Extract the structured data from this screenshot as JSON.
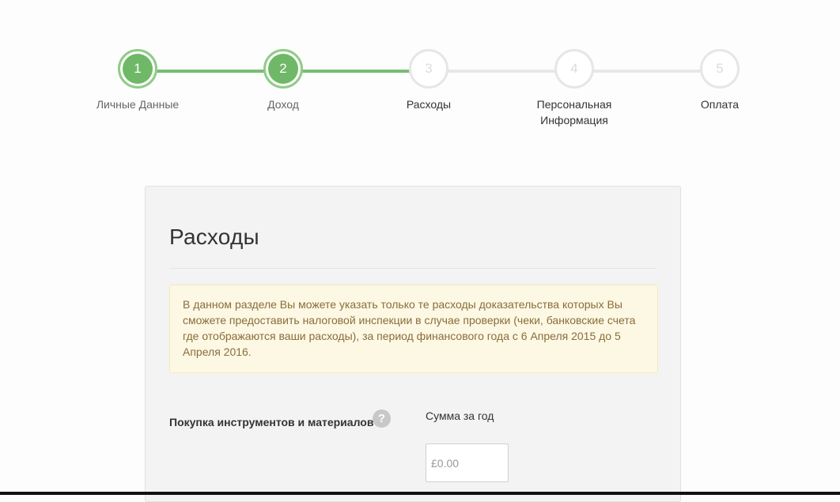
{
  "stepper": {
    "steps": [
      {
        "number": "1",
        "label": "Личные Данные",
        "state": "done"
      },
      {
        "number": "2",
        "label": "Доход",
        "state": "done"
      },
      {
        "number": "3",
        "label": "Расходы",
        "state": "pending"
      },
      {
        "number": "4",
        "label": "Персональная Информация",
        "state": "pending"
      },
      {
        "number": "5",
        "label": "Оплата",
        "state": "pending"
      }
    ]
  },
  "section": {
    "title": "Расходы",
    "notice": "В данном разделе Вы можете указать только те расходы доказательства которых Вы сможете предоставить налоговой инспекции в случае проверки (чеки, банковские счета где отображаются ваши расходы), за период финансового года с 6 Апреля 2015 до 5 Апреля 2016."
  },
  "expense_field": {
    "label": "Покупка инструментов и материалов",
    "help_icon": "?",
    "column_header": "Сумма за год",
    "amount_placeholder": "£0.00",
    "amount_value": ""
  },
  "colors": {
    "progress_green": "#6fb867",
    "progress_track": "#e7e7e7",
    "notice_background": "#fcf8e3",
    "notice_text": "#8a6d3b"
  }
}
